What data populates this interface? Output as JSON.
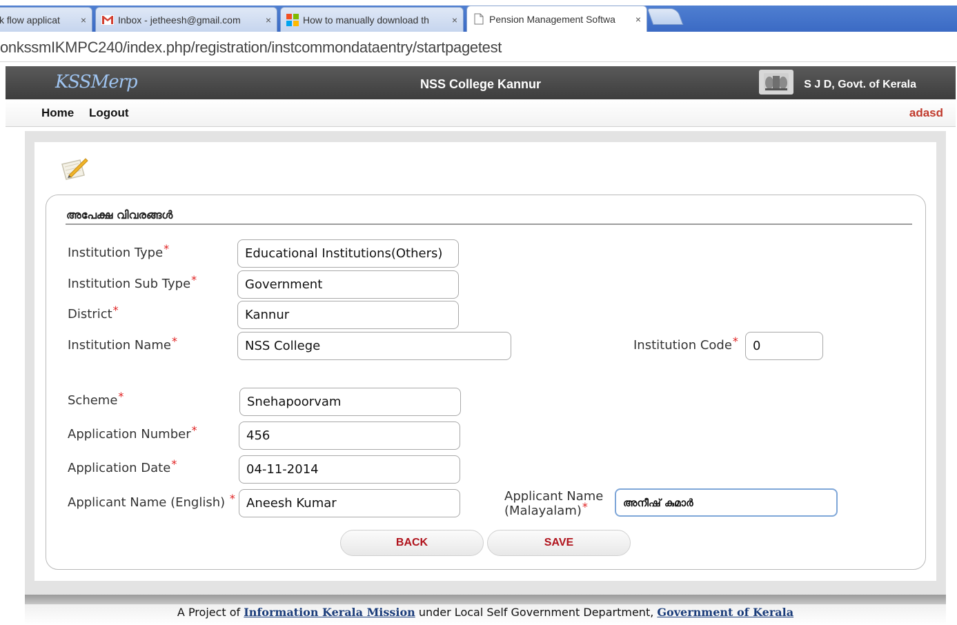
{
  "browser": {
    "tabs": [
      {
        "title": "k flow applicat",
        "favicon": "document-icon"
      },
      {
        "title": "Inbox - jetheesh@gmail.com",
        "favicon": "gmail-icon"
      },
      {
        "title": "How to manually download th",
        "favicon": "windows-icon"
      },
      {
        "title": "Pension Management Softwa",
        "favicon": "page-icon",
        "active": true
      }
    ],
    "close_glyph": "×",
    "url": "onkssmIKMPC240/index.php/registration/instcommondataentry/startpagetest"
  },
  "header": {
    "logo": "KSSMerp",
    "college": "NSS College Kannur",
    "govt": "S J D, Govt. of Kerala"
  },
  "menu": {
    "home": "Home",
    "logout": "Logout",
    "user": "adasd"
  },
  "form": {
    "section_title": "അപേക്ഷ വിവരങ്ങൾ",
    "required_mark": "*",
    "fields": {
      "institution_type": {
        "label": "Institution Type",
        "value": "Educational Institutions(Others)"
      },
      "institution_sub_type": {
        "label": "Institution Sub Type",
        "value": "Government"
      },
      "district": {
        "label": "District",
        "value": "Kannur"
      },
      "institution_name": {
        "label": "Institution Name",
        "value": "NSS College"
      },
      "institution_code": {
        "label": "Institution Code",
        "value": "0"
      },
      "scheme": {
        "label": "Scheme",
        "value": "Snehapoorvam"
      },
      "application_number": {
        "label": "Application Number",
        "value": "456"
      },
      "application_date": {
        "label": "Application Date",
        "value": "04-11-2014"
      },
      "applicant_name_en": {
        "label": "Applicant Name (English)",
        "value": "Aneesh Kumar"
      },
      "applicant_name_ml": {
        "label_line1": "Applicant Name",
        "label_line2": "(Malayalam)",
        "value": "അനീഷ് കുമാർ"
      }
    },
    "buttons": {
      "back": "BACK",
      "save": "SAVE"
    }
  },
  "footer": {
    "prefix": "A Project of",
    "link1": "Information Kerala Mission",
    "middle": "under Local Self Government Department,",
    "link2": "Government of Kerala"
  }
}
